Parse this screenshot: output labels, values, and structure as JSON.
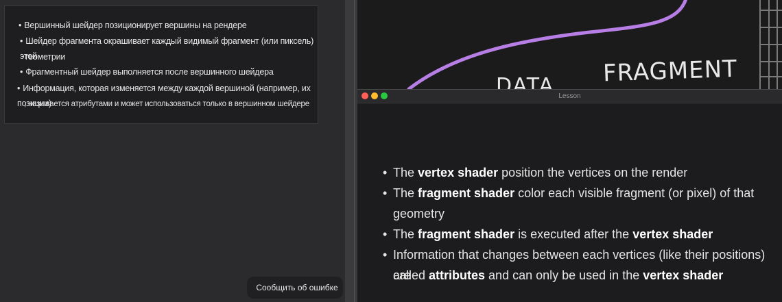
{
  "translation": {
    "items": [
      {
        "line1": "Вершинный шейдер позиционирует вершины на рендере",
        "line2": ""
      },
      {
        "line1": "Шейдер фрагмента окрашивает каждый видимый фрагмент (или пиксель) этой",
        "line2": "геометрии"
      },
      {
        "line1": "Фрагментный шейдер выполняется после вершинного шейдера",
        "line2": ""
      },
      {
        "line1": "Информация, которая изменяется между каждой вершиной (например, их позиции)",
        "line2": ", называется атрибутами и может использоваться только в вершинном шейдере"
      }
    ]
  },
  "report_button": {
    "label": "Сообщить об ошибке"
  },
  "video": {
    "handwriting_1": "DATA",
    "handwriting_2": "FRAGMENT",
    "curve_color": "#b77ee6"
  },
  "lesson_window": {
    "title": "Lesson",
    "traffic_colors": {
      "close": "#ff5f57",
      "minimize": "#febc2e",
      "zoom": "#28c840"
    },
    "bullets": [
      {
        "parts": [
          {
            "t": "The ",
            "b": false
          },
          {
            "t": "vertex shader",
            "b": true
          },
          {
            "t": " position the vertices on the render",
            "b": false
          }
        ]
      },
      {
        "parts": [
          {
            "t": "The ",
            "b": false
          },
          {
            "t": "fragment shader",
            "b": true
          },
          {
            "t": " color each visible fragment (or pixel) of that",
            "b": false
          }
        ],
        "cont": "geometry"
      },
      {
        "parts": [
          {
            "t": "The ",
            "b": false
          },
          {
            "t": "fragment shader",
            "b": true
          },
          {
            "t": " is executed after the ",
            "b": false
          },
          {
            "t": "vertex shader",
            "b": true
          }
        ]
      },
      {
        "parts": [
          {
            "t": "Information that changes between each vertices (like their positions) are",
            "b": false
          }
        ],
        "cont_parts": [
          {
            "t": "called ",
            "b": false
          },
          {
            "t": "attributes",
            "b": true
          },
          {
            "t": " and can only be used in the ",
            "b": false
          },
          {
            "t": "vertex shader",
            "b": true
          }
        ]
      }
    ]
  }
}
